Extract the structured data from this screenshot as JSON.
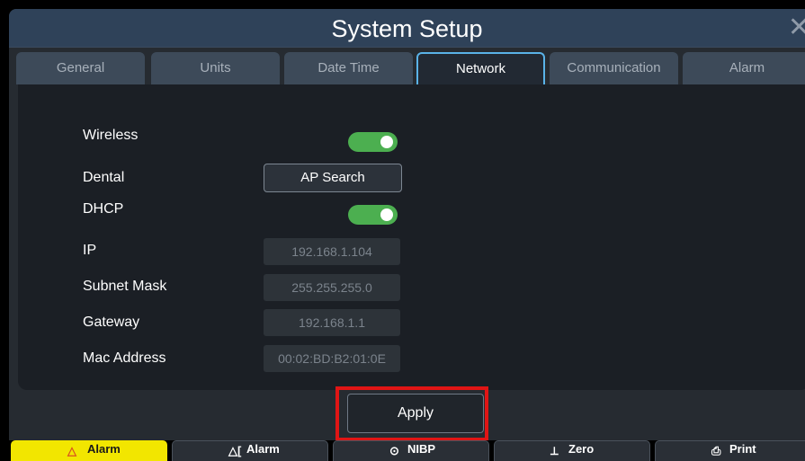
{
  "window": {
    "title": "System Setup",
    "close_glyph": "✕"
  },
  "tabs": [
    {
      "label": "General",
      "active": false
    },
    {
      "label": "Units",
      "active": false
    },
    {
      "label": "Date Time",
      "active": false
    },
    {
      "label": "Network",
      "active": true
    },
    {
      "label": "Communication",
      "active": false
    },
    {
      "label": "Alarm",
      "active": false
    }
  ],
  "network": {
    "wireless_label": "Wireless",
    "wireless_on": true,
    "dental_label": "Dental",
    "ap_search_label": "AP Search",
    "dhcp_label": "DHCP",
    "dhcp_on": true,
    "ip_label": "IP",
    "ip_value": "192.168.1.104",
    "subnet_label": "Subnet Mask",
    "subnet_value": "255.255.255.0",
    "gateway_label": "Gateway",
    "gateway_value": "192.168.1.1",
    "mac_label": "Mac Address",
    "mac_value": "00:02:BD:B2:01:0E"
  },
  "apply_label": "Apply",
  "bottom_bar": [
    {
      "label": "Alarm",
      "icon": "alarm-triangle-icon"
    },
    {
      "label": "Alarm",
      "icon": "alarm-mute-icon"
    },
    {
      "label": "NIBP",
      "icon": "clock-icon"
    },
    {
      "label": "",
      "icon": ""
    },
    {
      "label": "Zero",
      "icon": "zero-icon"
    },
    {
      "label": "Print",
      "icon": "printer-icon"
    }
  ],
  "colors": {
    "toggle_on": "#4caf50",
    "active_tab_border": "#5ab3e8",
    "highlight": "#e01515",
    "alarm_button": "#f2e600"
  }
}
